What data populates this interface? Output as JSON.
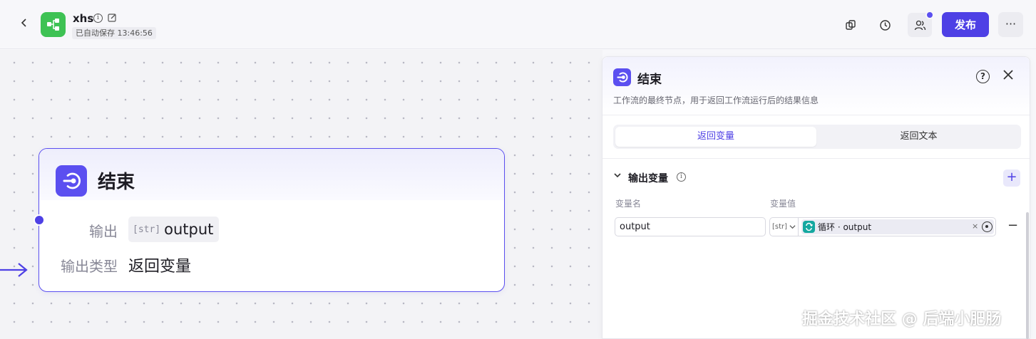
{
  "header": {
    "back_icon": "chevron-left-icon",
    "app_name": "xhs",
    "save_status": "已自动保存 13:46:56",
    "publish_label": "发布",
    "more_label": "···",
    "brand_color": "#4e40e5",
    "logo_color": "#3ec254"
  },
  "node": {
    "title": "结束",
    "output_label": "输出",
    "output_type_tag": "[str]",
    "output_name": "output",
    "output_type_label": "输出类型",
    "output_type_value": "返回变量"
  },
  "panel": {
    "title": "结束",
    "description": "工作流的最终节点，用于返回工作流运行后的结果信息",
    "tabs": [
      {
        "label": "返回变量",
        "active": true
      },
      {
        "label": "返回文本",
        "active": false
      }
    ],
    "section_title": "输出变量",
    "columns": {
      "name": "变量名",
      "value": "变量值"
    },
    "rows": [
      {
        "name": "output",
        "type_tag": "[str]",
        "ref_text": "循环 · output",
        "clear": "×"
      }
    ],
    "add_label": "+",
    "remove_label": "−"
  },
  "watermark": "掘金技术社区 @ 后端小肥肠"
}
